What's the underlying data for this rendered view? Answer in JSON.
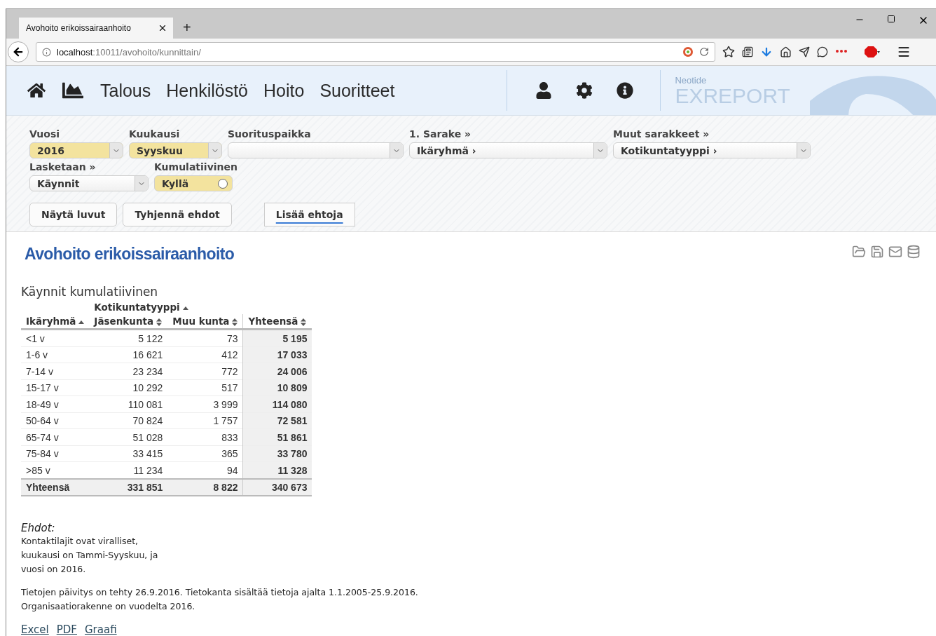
{
  "browser": {
    "tab_title": "Avohoito erikoissairaanhoito",
    "new_tab": "+",
    "url_host": "localhost",
    "url_path": ":10011/avohoito/kunnittain/"
  },
  "nav": {
    "links": [
      "Talous",
      "Henkilöstö",
      "Hoito",
      "Suoritteet"
    ],
    "logo_small": "Neotide",
    "logo_big": "EXREPORT"
  },
  "filters": {
    "row_1": [
      {
        "kind": "select",
        "label": "Vuosi",
        "value": "2016",
        "highlighted": true
      },
      {
        "kind": "select",
        "label": "Kuukausi",
        "value": "Syyskuu",
        "highlighted": true
      },
      {
        "kind": "select",
        "label": "Suorituspaikka",
        "highlighted": false
      },
      {
        "kind": "select",
        "label": "1. Sarake »",
        "value": "Ikäryhmä ›",
        "highlighted": false
      },
      {
        "kind": "select",
        "label": "Muut sarakkeet »",
        "value": "Kotikuntatyyppi ›",
        "highlighted": false
      }
    ],
    "row_2": [
      {
        "kind": "select",
        "label": "Lasketaan »",
        "value": "Käynnit",
        "highlighted": false
      },
      {
        "kind": "toggle",
        "label": "Kumulatiivinen",
        "value": "Kyllä",
        "highlighted": true
      }
    ],
    "buttons": [
      {
        "label": "Näytä luvut",
        "active": false
      },
      {
        "label": "Tyhjennä ehdot",
        "active": false
      },
      {
        "label": "Lisää ehtoja",
        "active": true
      }
    ]
  },
  "report": {
    "title": "Avohoito erikoissairaanhoito",
    "table_title": "Käynnit kumulatiivinen",
    "group_header": {
      "label": "Kotikuntatyyppi",
      "sorted": true
    },
    "columns": [
      {
        "label": "Ikäryhmä",
        "sorted": true
      },
      {
        "label": "Jäsenkunta",
        "sorted": false
      },
      {
        "label": "Muu kunta",
        "sorted": false
      },
      {
        "label": "Yhteensä",
        "sorted": false
      }
    ],
    "rows": [
      [
        "<1 v",
        "5 122",
        "73",
        "5 195"
      ],
      [
        "1-6 v",
        "16 621",
        "412",
        "17 033"
      ],
      [
        "7-14 v",
        "23 234",
        "772",
        "24 006"
      ],
      [
        "15-17 v",
        "10 292",
        "517",
        "10 809"
      ],
      [
        "18-49 v",
        "110 081",
        "3 999",
        "114 080"
      ],
      [
        "50-64 v",
        "70 824",
        "1 757",
        "72 581"
      ],
      [
        "65-74 v",
        "51 028",
        "833",
        "51 861"
      ],
      [
        "75-84 v",
        "33 415",
        "365",
        "33 780"
      ],
      [
        ">85 v",
        "11 234",
        "94",
        "11 328"
      ]
    ],
    "total": [
      "Yhteensä",
      "331 851",
      "8 822",
      "340 673"
    ],
    "conditions_title": "Ehdot:",
    "conditions": [
      "Kontaktilajit ovat viralliset,",
      "kuukausi on Tammi-Syyskuu, ja",
      "vuosi on 2016."
    ],
    "notes": [
      "Tietojen päivitys on tehty 26.9.2016. Tietokanta sisältää tietoja ajalta 1.1.2005-25.9.2016.",
      "Organisaatiorakenne on vuodelta 2016."
    ],
    "links": [
      "Excel",
      "PDF",
      "Graafi"
    ]
  }
}
